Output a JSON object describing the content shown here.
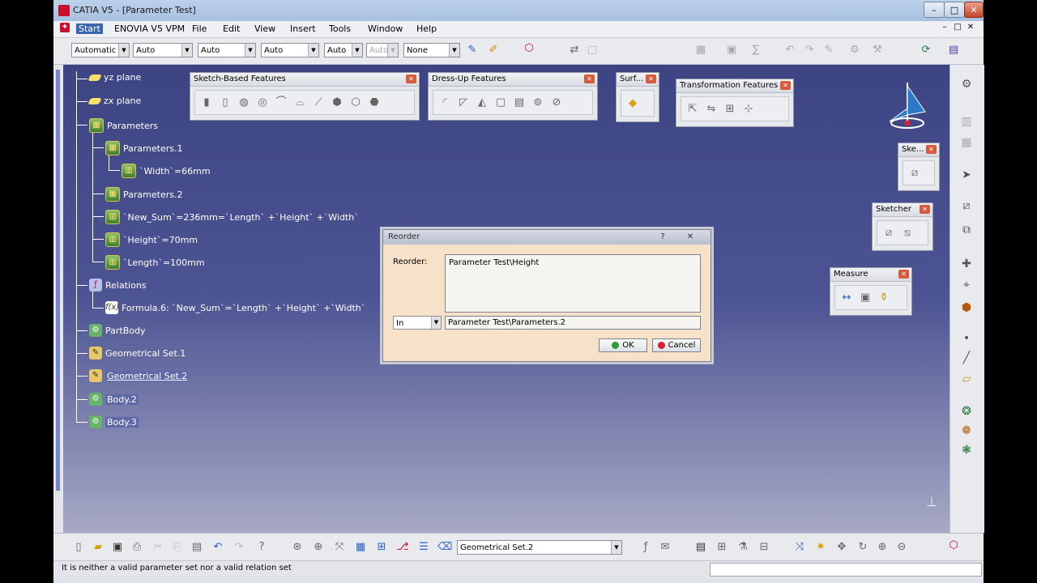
{
  "window": {
    "title": "CATIA V5 - [Parameter Test]",
    "controls": {
      "minimize": "–",
      "maximize": "□",
      "close": "✕"
    }
  },
  "menu": {
    "items": [
      "Start",
      "ENOVIA V5 VPM",
      "File",
      "Edit",
      "View",
      "Insert",
      "Tools",
      "Window",
      "Help"
    ],
    "doc_controls": [
      "–",
      "□",
      "✕"
    ]
  },
  "toolbar": {
    "combos": [
      "Automatic",
      "Auto",
      "Auto",
      "Auto",
      "Auto",
      "Auto",
      "None"
    ]
  },
  "tree": {
    "nodes": [
      {
        "label": "yz plane",
        "icon": "plane-icon"
      },
      {
        "label": "zx plane",
        "icon": "plane-icon"
      },
      {
        "label": "Parameters",
        "icon": "parameters-icon"
      },
      {
        "label": "Parameters.1",
        "icon": "parameters-icon"
      },
      {
        "label": "`Width`=66mm",
        "icon": "parameter-icon"
      },
      {
        "label": "Parameters.2",
        "icon": "parameters-icon"
      },
      {
        "label": "`New_Sum`=236mm=`Length` +`Height` +`Width`",
        "icon": "parameter-icon"
      },
      {
        "label": "`Height`=70mm",
        "icon": "parameter-icon"
      },
      {
        "label": "`Length`=100mm",
        "icon": "parameter-icon"
      },
      {
        "label": "Relations",
        "icon": "relations-icon"
      },
      {
        "label": "Formula.6: `New_Sum`=`Length` +`Height` +`Width`",
        "icon": "formula-icon"
      },
      {
        "label": "PartBody",
        "icon": "partbody-icon"
      },
      {
        "label": "Geometrical Set.1",
        "icon": "geometrical-set-icon"
      },
      {
        "label": "Geometrical Set.2",
        "icon": "geometrical-set-icon"
      },
      {
        "label": "Body.2",
        "icon": "body-icon"
      },
      {
        "label": "Body.3",
        "icon": "body-icon"
      }
    ]
  },
  "palettes": {
    "sketch_based": "Sketch-Based Features",
    "dress_up": "Dress-Up Features",
    "surf": "Surf...",
    "transformation": "Transformation Features",
    "ske": "Ske...",
    "sketcher": "Sketcher",
    "measure": "Measure"
  },
  "dialog": {
    "title": "Reorder",
    "help": "?",
    "close": "✕",
    "label": "Reorder:",
    "list_value": "Parameter Test\\Height",
    "position_select": "In",
    "target_value": "Parameter Test\\Parameters.2",
    "ok": "OK",
    "cancel": "Cancel"
  },
  "bottom_toolbar": {
    "current_set": "Geometrical Set.2"
  },
  "status": {
    "message": "It is neither a valid parameter set nor a valid relation set"
  },
  "colors": {
    "canvas_top": "#3d4483",
    "canvas_bottom": "#a7a9c4",
    "dialog_bg": "#f7e1c9",
    "menu_active": "#3a66b0"
  }
}
